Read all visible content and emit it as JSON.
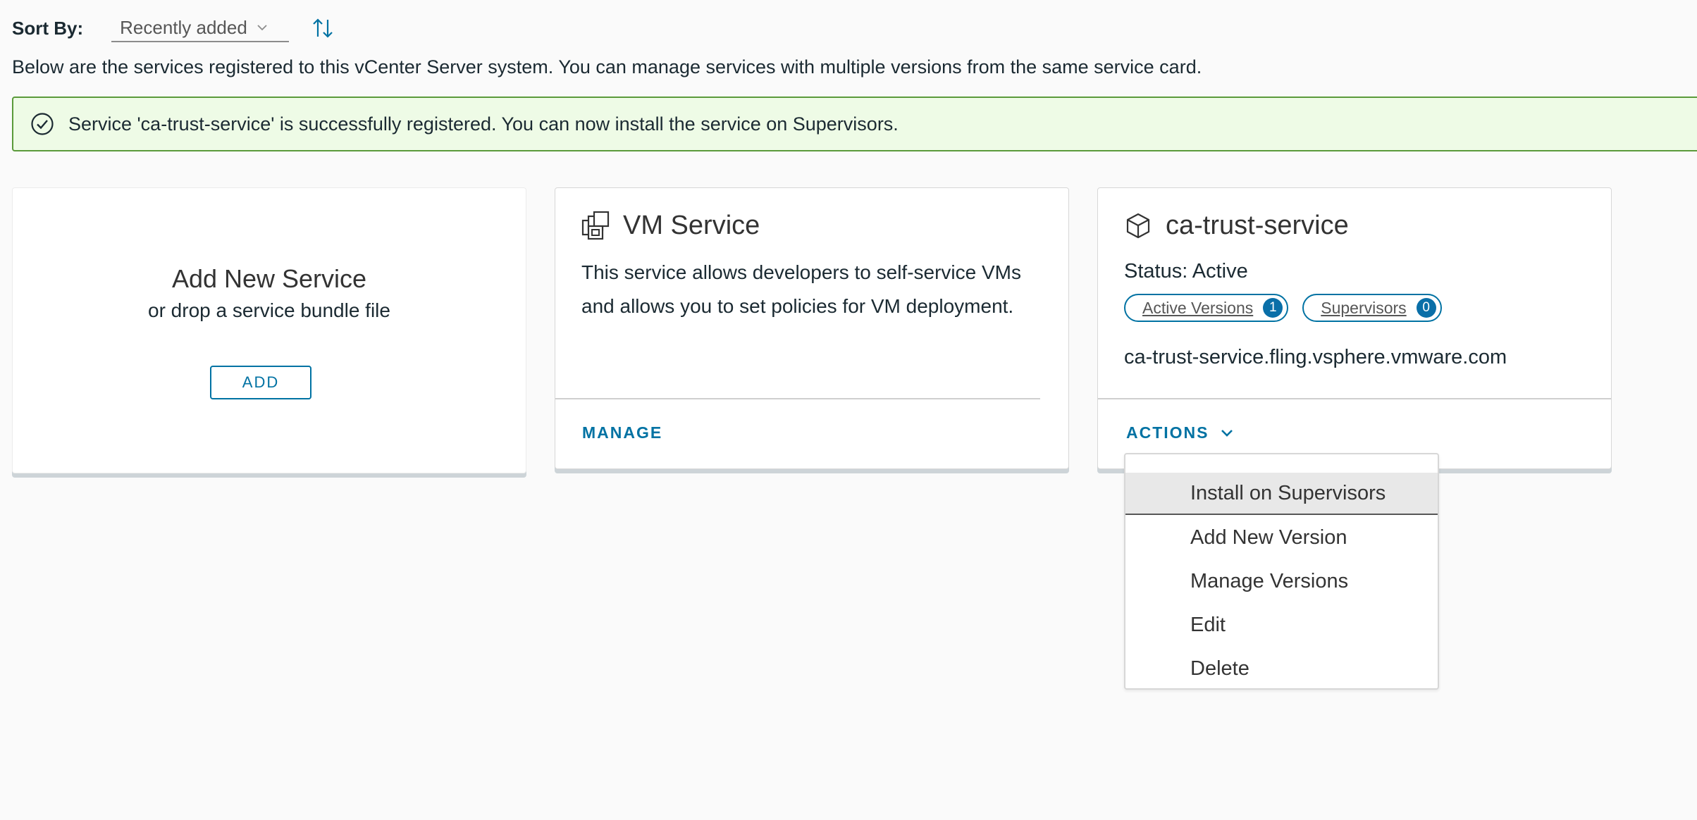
{
  "sort": {
    "label": "Sort By:",
    "selected": "Recently added"
  },
  "intro_text": "Below are the services registered to this vCenter Server system. You can manage services with multiple versions from the same service card.",
  "alert": {
    "message": "Service 'ca-trust-service' is successfully registered. You can now install the service on Supervisors.",
    "status_color": "#5a9a3a"
  },
  "add_card": {
    "title": "Add New Service",
    "subtitle": "or drop a service bundle file",
    "button_label": "ADD"
  },
  "vm_card": {
    "title": "VM Service",
    "description": "This service allows developers to self-service VMs and allows you to set policies for VM deployment.",
    "link_label": "MANAGE",
    "icon": "vm-service-icon"
  },
  "ca_card": {
    "title": "ca-trust-service",
    "status": "Status: Active",
    "badges": [
      {
        "label": "Active Versions",
        "count": "1"
      },
      {
        "label": "Supervisors",
        "count": "0"
      }
    ],
    "domain": "ca-trust-service.fling.vsphere.vmware.com",
    "actions_label": "ACTIONS",
    "icon": "cube-icon"
  },
  "actions_menu": {
    "items": [
      "Install on Supervisors",
      "Add New Version",
      "Manage Versions",
      "Edit",
      "Delete"
    ]
  },
  "colors": {
    "accent": "#0072a3",
    "alert_bg": "#eefbe6",
    "badge_bg": "#0a6fa8"
  }
}
